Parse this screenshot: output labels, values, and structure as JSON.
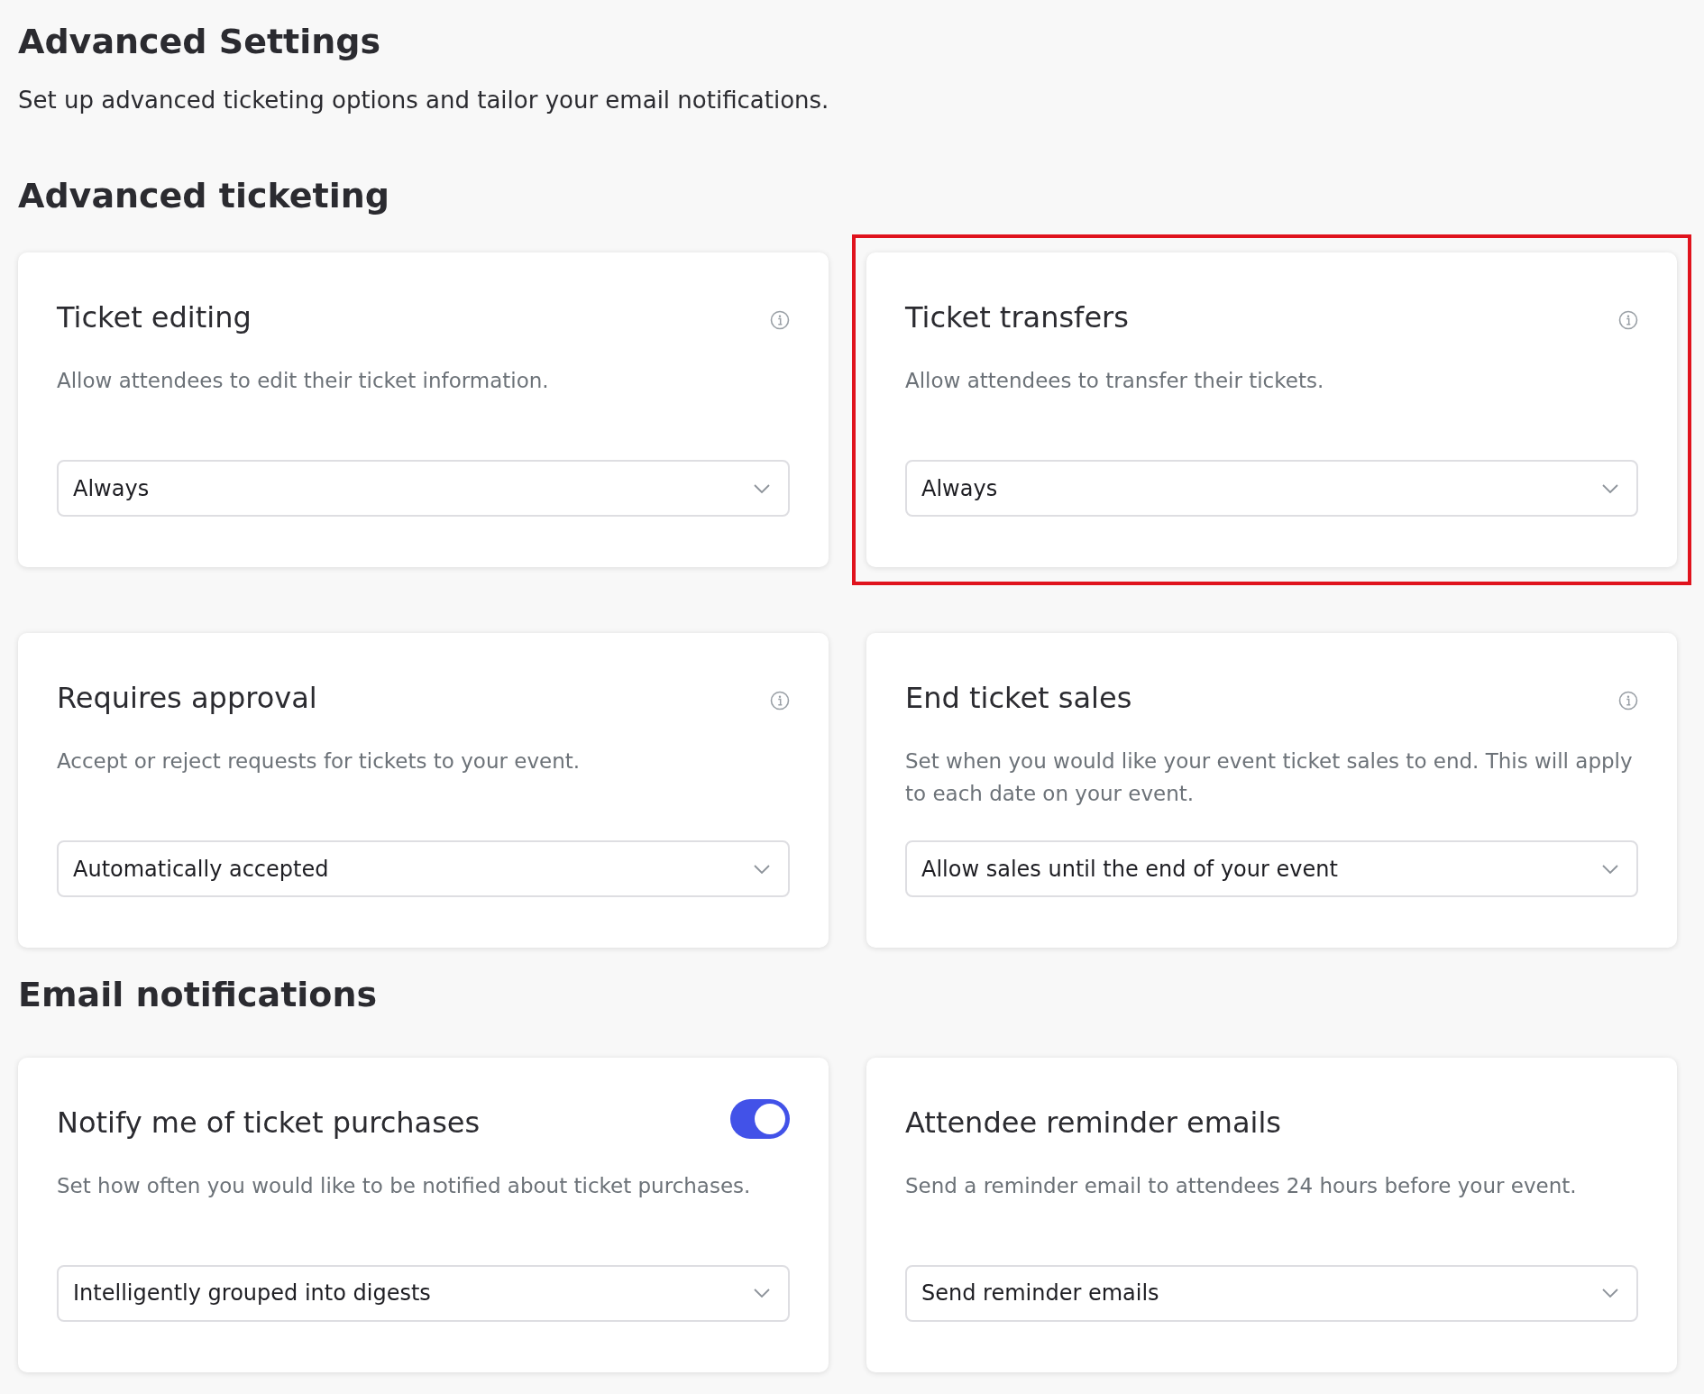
{
  "page": {
    "title": "Advanced Settings",
    "subtitle": "Set up advanced ticketing options and tailor your email notifications."
  },
  "sections": [
    {
      "heading": "Advanced ticketing",
      "cards": [
        {
          "title": "Ticket editing",
          "kind": "info",
          "highlighted": false,
          "description": "Allow attendees to edit their ticket information.",
          "select": {
            "value": "Always"
          }
        },
        {
          "title": "Ticket transfers",
          "kind": "info",
          "highlighted": true,
          "description": "Allow attendees to transfer their tickets.",
          "select": {
            "value": "Always"
          }
        },
        {
          "title": "Requires approval",
          "kind": "info",
          "highlighted": false,
          "description": "Accept or reject requests for tickets to your event.",
          "select": {
            "value": "Automatically accepted"
          }
        },
        {
          "title": "End ticket sales",
          "kind": "info",
          "highlighted": false,
          "description": "Set when you would like your event ticket sales to end. This will apply to each date on your event.",
          "select": {
            "value": "Allow sales until the end of your event"
          }
        }
      ]
    },
    {
      "heading": "Email notifications",
      "cards": [
        {
          "title": "Notify me of ticket purchases",
          "kind": "toggle",
          "on": true,
          "highlighted": false,
          "description": "Set how often you would like to be notified about ticket purchases.",
          "select": {
            "value": "Intelligently grouped into digests"
          }
        },
        {
          "title": "Attendee reminder emails",
          "kind": "plain",
          "highlighted": false,
          "description": "Send a reminder email to attendees 24 hours before your event.",
          "select": {
            "value": "Send reminder emails"
          }
        }
      ]
    }
  ]
}
